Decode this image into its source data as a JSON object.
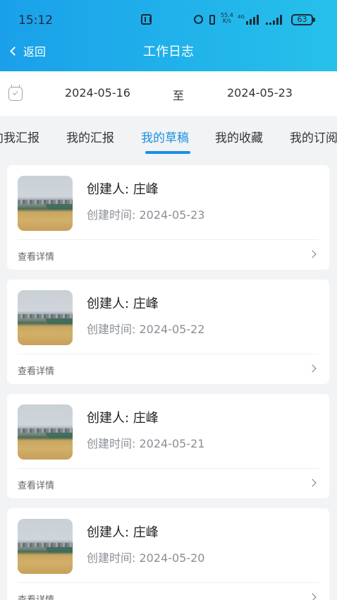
{
  "status_bar": {
    "time": "15:12",
    "net_speed_value": "55.4",
    "net_speed_unit": "K/s",
    "network_type": "4G",
    "battery": "63"
  },
  "header": {
    "back_label": "返回",
    "title": "工作日志",
    "background_color": "#1fa9ea"
  },
  "date_range": {
    "start": "2024-05-16",
    "separator": "至",
    "end": "2024-05-23"
  },
  "tabs": [
    {
      "label": "向我汇报"
    },
    {
      "label": "我的汇报"
    },
    {
      "label": "我的草稿",
      "active": true
    },
    {
      "label": "我的收藏"
    },
    {
      "label": "我的订阅"
    }
  ],
  "accent_color": "#1a8fe3",
  "drafts": [
    {
      "creator": "创建人: 庄峰",
      "created": "创建时间: 2024-05-23",
      "detail_label": "查看详情"
    },
    {
      "creator": "创建人: 庄峰",
      "created": "创建时间: 2024-05-22",
      "detail_label": "查看详情"
    },
    {
      "creator": "创建人: 庄峰",
      "created": "创建时间: 2024-05-21",
      "detail_label": "查看详情"
    },
    {
      "creator": "创建人: 庄峰",
      "created": "创建时间: 2024-05-20",
      "detail_label": "查看详情"
    }
  ]
}
